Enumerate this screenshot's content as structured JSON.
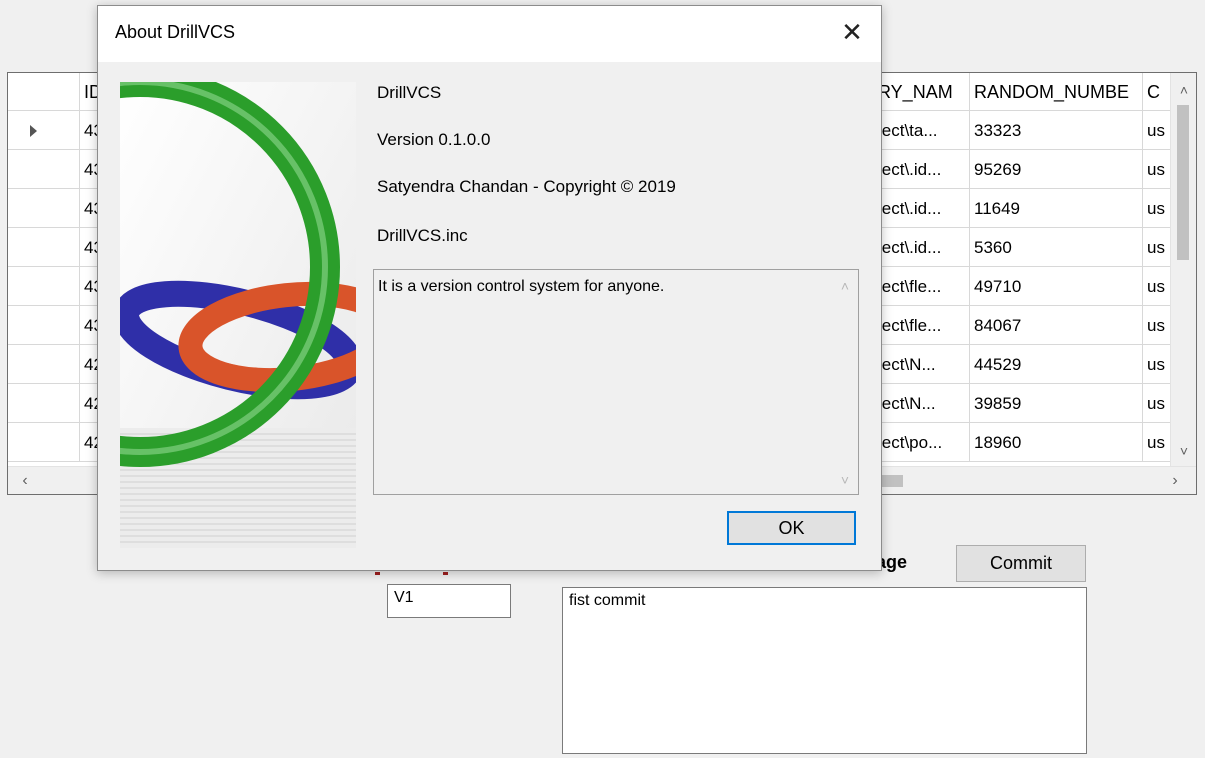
{
  "grid": {
    "columns": [
      {
        "label": "ID"
      },
      {
        "label": "RY_NAM"
      },
      {
        "label": "RANDOM_NUMBE"
      },
      {
        "label": "C"
      }
    ],
    "rows": [
      {
        "id": "43",
        "path": "ject\\ta...",
        "random": "33323",
        "c": "us"
      },
      {
        "id": "43",
        "path": "ject\\.id...",
        "random": "95269",
        "c": "us"
      },
      {
        "id": "43",
        "path": "ject\\.id...",
        "random": "11649",
        "c": "us"
      },
      {
        "id": "43",
        "path": "ject\\.id...",
        "random": "5360",
        "c": "us"
      },
      {
        "id": "43",
        "path": "ject\\fle...",
        "random": "49710",
        "c": "us"
      },
      {
        "id": "43",
        "path": "ject\\fle...",
        "random": "84067",
        "c": "us"
      },
      {
        "id": "42",
        "path": "ject\\N...",
        "random": "44529",
        "c": "us"
      },
      {
        "id": "42",
        "path": "ject\\N...",
        "random": "39859",
        "c": "us"
      },
      {
        "id": "42",
        "path": "ject\\po...",
        "random": "18960",
        "c": "us"
      }
    ]
  },
  "commit_area": {
    "message_label": "age",
    "commit_button": "Commit",
    "version_value": "V1",
    "message_value": "fist commit"
  },
  "dialog": {
    "title": "About DrillVCS",
    "product": "DrillVCS",
    "version": "Version 0.1.0.0",
    "copyright": "Satyendra Chandan - Copyright © 2019",
    "company": "DrillVCS.inc",
    "description": "It is a version control system for anyone.",
    "ok_label": "OK",
    "close_glyph": "✕"
  },
  "icons": {
    "scroll_up": "˄",
    "scroll_down": "˅",
    "scroll_left": "‹",
    "scroll_right": "›"
  }
}
